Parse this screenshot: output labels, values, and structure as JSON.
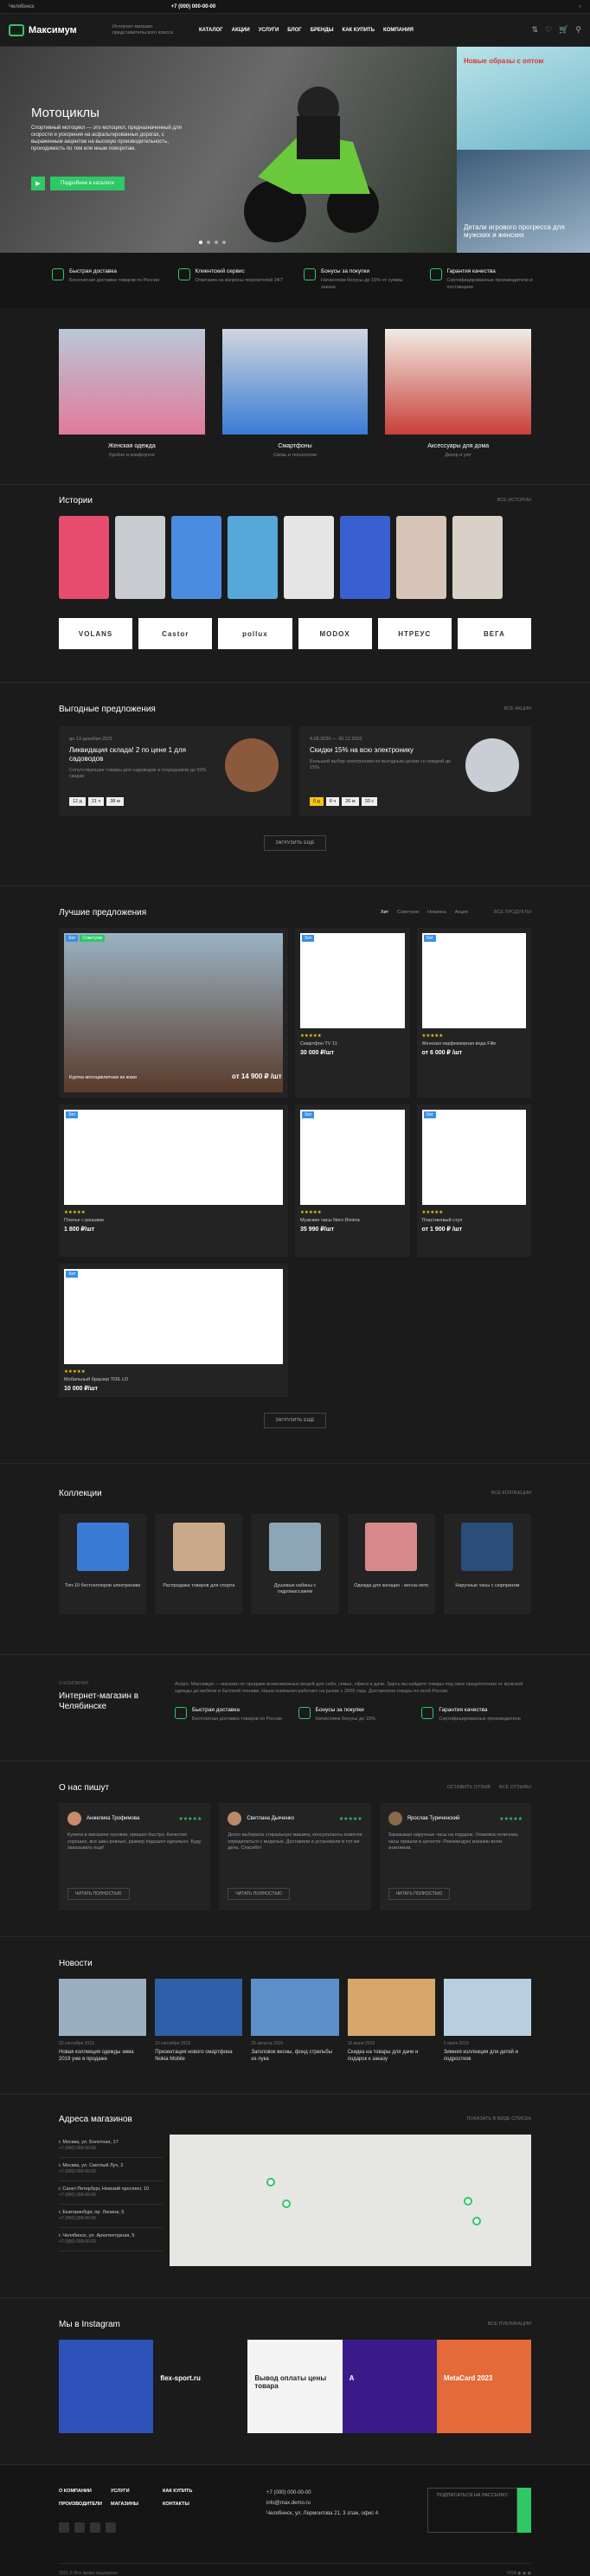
{
  "topbar": {
    "city": "Челябинск",
    "phone": "+7 (000) 000-00-00"
  },
  "header": {
    "logo": "Максимум",
    "tagline": "Интернет-магазин представительского класса",
    "nav": [
      "КАТАЛОГ",
      "АКЦИИ",
      "УСЛУГИ",
      "БЛОГ",
      "БРЕНДЫ",
      "КАК КУПИТЬ",
      "КОМПАНИЯ"
    ]
  },
  "hero": {
    "title": "Мотоциклы",
    "text": "Спортивный мотоцикл — это мотоцикл, предназначенный для скорости и ускорения на асфальтированных дорогах, с выраженным акцентом на высокую производительность, проходимость по тем или иным поворотам.",
    "button": "Подробнее в каталоге",
    "side1": "Новые образы с оптом",
    "side2": "Детали игрового прогресса для мужских и женских"
  },
  "benefits": [
    {
      "title": "Быстрая доставка",
      "text": "Бесплатная доставка товаров по России"
    },
    {
      "title": "Клиентский сервис",
      "text": "Отвечаем на вопросы покупателей 24/7"
    },
    {
      "title": "Бонусы за покупки",
      "text": "Начисляем бонусы до 15% от суммы заказа"
    },
    {
      "title": "Гарантия качества",
      "text": "Сертифицированные производители и поставщики"
    }
  ],
  "categories": [
    {
      "name": "Женская одежда",
      "desc": "Удобно и комфортно"
    },
    {
      "name": "Смартфоны",
      "desc": "Связь и технологии"
    },
    {
      "name": "Аксессуары для дома",
      "desc": "Декор и уют"
    }
  ],
  "stories": {
    "title": "Истории",
    "link": "ВСЕ ИСТОРИИ"
  },
  "brands": [
    "VOLANS",
    "Castor",
    "pollux",
    "MODOX",
    "НТРЕУС",
    "ВЕГА"
  ],
  "offers": {
    "title": "Выгодные предложения",
    "link": "ВСЕ АКЦИИ",
    "items": [
      {
        "date": "до 13 декабря 2021",
        "title": "Ликвидация склада! 2 по цене 1 для садоводов",
        "text": "Сопутствующие товары для садоводов и огородников до 50% скидки",
        "timer": [
          "12 д",
          "21 ч",
          "38 м"
        ]
      },
      {
        "date": "4.09.2020 — 30.12.2020",
        "title": "Скидки 15% на всю электронику",
        "text": "Большой выбор электроники по выгодным ценам со скидкой до 15%",
        "timer": [
          "0 д",
          "8 ч",
          "26 м",
          "33 с"
        ]
      }
    ],
    "more": "ЗАГРУЗИТЬ ЕЩЁ"
  },
  "best": {
    "title": "Лучшие предложения",
    "tabs": [
      "Хит",
      "Советуем",
      "Новинка",
      "Акция"
    ],
    "link": "ВСЕ ПРОДУКТЫ",
    "products": [
      {
        "name": "Куртка мотоциклетная из кожи",
        "price": "от 14 900 ₽ /шт",
        "big": true
      },
      {
        "name": "Смартфон TV 11",
        "price": "30 000 ₽/шт"
      },
      {
        "name": "Женская парфюмерная вода Fille",
        "price": "от 6 000 ₽ /шт"
      },
      {
        "name": "Платье с рюшами",
        "price": "1 800 ₽/шт"
      },
      {
        "name": "Мужские часы Nero Riviera",
        "price": "35 990 ₽/шт"
      },
      {
        "name": "Пластиковый стул",
        "price": "от 1 900 ₽ /шт"
      },
      {
        "name": "Мобильный браузер TOIL LD",
        "price": "10 000 ₽/шт"
      }
    ],
    "more": "ЗАГРУЗИТЬ ЕЩЁ"
  },
  "collections": {
    "title": "Коллекции",
    "link": "ВСЕ КОЛЛЕКЦИИ",
    "items": [
      "Топ-10 бестселлеров электроники",
      "Распродажа товаров для спорта",
      "Душевые кабины с гидромассажем",
      "Одежда для женщин - весна-лето",
      "Наручные часы с сюрпризом"
    ]
  },
  "about": {
    "sub": "О КОМПАНИИ",
    "title": "Интернет-магазин в Челябинске",
    "text": "Аспро: Максимум — магазин по продаже всевозможных вещей для себя, семьи, офиса и дачи. Здесь вы найдете товары под свои предпочтения от мужской одежды до мебели и бытовой техники. Наша компания работает на рынке с 2005 года. Доставляем товары по всей России.",
    "items": [
      {
        "title": "Быстрая доставка",
        "text": "Бесплатная доставка товаров по России"
      },
      {
        "title": "Бонусы за покупки",
        "text": "Начисляем бонусы до 15%"
      },
      {
        "title": "Гарантия качества",
        "text": "Сертифицированные производители"
      }
    ]
  },
  "reviews": {
    "title": "О нас пишут",
    "link1": "ОСТАВИТЬ ОТЗЫВ",
    "link2": "ВСЕ ОТЗЫВЫ",
    "items": [
      {
        "name": "Анжелика Трофимова",
        "text": "Купила в магазине пуховик, пришел быстро. Качество хорошее, все швы ровные, размер подошел идеально. Буду заказывать еще!",
        "more": "ЧИТАТЬ ПОЛНОСТЬЮ"
      },
      {
        "name": "Светлана Дьяченко",
        "text": "Долго выбирала стиральную машину, консультанты помогли определиться с моделью. Доставили и установили в тот же день. Спасибо!",
        "more": "ЧИТАТЬ ПОЛНОСТЬЮ"
      },
      {
        "name": "Ярослав Туриченский",
        "text": "Заказывал наручные часы на подарок. Упаковка отличная, часы пришли в целости. Рекомендую магазин всем знакомым.",
        "more": "ЧИТАТЬ ПОЛНОСТЬЮ"
      }
    ]
  },
  "news": {
    "title": "Новости",
    "items": [
      {
        "date": "23 сентября 2019",
        "title": "Новая коллекция одежды зима 2019 уже в продаже"
      },
      {
        "date": "10 сентября 2019",
        "title": "Презентация нового смартфона Nokia Mobile"
      },
      {
        "date": "25 августа 2019",
        "title": "Заголовок весны, фонд стрельбы из лука"
      },
      {
        "date": "10 июня 2019",
        "title": "Скидка на товары для дачи и подарок к заказу"
      },
      {
        "date": "5 июля 2019",
        "title": "Зимняя коллекция для детей и подростков"
      }
    ]
  },
  "shops": {
    "title": "Адреса магазинов",
    "link": "ПОКАЗАТЬ В ВИДЕ СПИСКА",
    "items": [
      {
        "addr": "г. Москва, ул. Болотная, 17",
        "phone": "+7 (000) 000-00-00"
      },
      {
        "addr": "г. Москва, ул. Светлый Луч, 2",
        "phone": "+7 (000) 000-00-00"
      },
      {
        "addr": "г. Санкт-Петербург, Невский проспект, 10",
        "phone": "+7 (000) 000-00-00"
      },
      {
        "addr": "г. Екатеринбург, пр. Ленина, 5",
        "phone": "+7 (000) 000-00-00"
      },
      {
        "addr": "г. Челябинск, ул. Архитектурная, 5",
        "phone": "+7 (000) 000-00-00"
      }
    ]
  },
  "instagram": {
    "title": "Мы в Instagram",
    "link": "ВСЕ ПУБЛИКАЦИИ",
    "posts": [
      "",
      "flex-sport.ru",
      "Вывод оплаты цены товара",
      "A",
      "MetaCard 2023"
    ]
  },
  "footer": {
    "links": [
      "О КОМПАНИИ",
      "УСЛУГИ",
      "КАК КУПИТЬ",
      "ПРОИЗВОДИТЕЛИ",
      "МАГАЗИНЫ",
      "КОНТАКТЫ"
    ],
    "phone": "+7 (000) 000-00-00",
    "email": "info@max.demo.ru",
    "address": "Челябинск, ул. Лермонтова 21, 3 этаж, офис 4",
    "subscribe": "ПОДПИСАТЬСЯ НА РАССЫЛКУ",
    "copyright": "2021 © Все права защищены"
  },
  "colors": {
    "accent": "#2ec866",
    "bg": "#1b1b1b",
    "card": "#232323"
  }
}
